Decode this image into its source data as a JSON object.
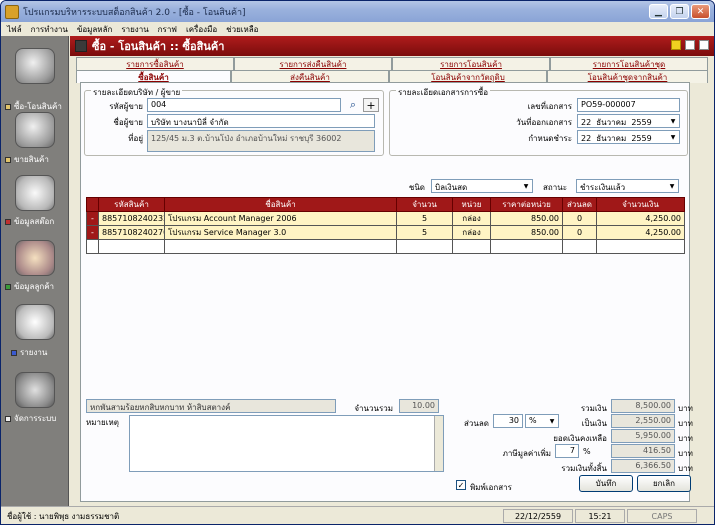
{
  "window": {
    "title": "โปรแกรมบริหารระบบสต็อกสินค้า 2.0  - [ซื้อ - โอนสินค้า]"
  },
  "menu": [
    "ไฟล์",
    "การทำงาน",
    "ข้อมูลหลัก",
    "รายงาน",
    "กราฟ",
    "เครื่องมือ",
    "ช่วยเหลือ"
  ],
  "sidebar": [
    {
      "label": "ซื้อ-โอนสินค้า",
      "icon": "magnifier-icon"
    },
    {
      "label": "ขายสินค้า",
      "icon": "magnifier-icon"
    },
    {
      "label": "ข้อมูลสต๊อก",
      "icon": "documents-icon"
    },
    {
      "label": "ข้อมูลลูกค้า",
      "icon": "customer-icon"
    },
    {
      "label": "รายงาน",
      "icon": "printer-icon"
    },
    {
      "label": "จัดการระบบ",
      "icon": "gears-icon"
    }
  ],
  "header": {
    "title": "ซื้อ - โอนสินค้า :: ซื้อสินค้า"
  },
  "tabs_top": [
    "รายการซื้อสินค้า",
    "รายการส่งคืนสินค้า",
    "รายการโอนสินค้า",
    "รายการโอนสินค้าชุด"
  ],
  "tabs_bottom": [
    "ซื้อสินค้า",
    "ส่งคืนสินค้า",
    "โอนสินค้าจากวัตถุดิบ",
    "โอนสินค้าชุดจากสินค้า"
  ],
  "supplier": {
    "group_title": "รายละเอียดบริษัท / ผู้ขาย",
    "code_label": "รหัสผู้ขาย",
    "code_value": "004",
    "name_label": "ชื่อผู้ขาย",
    "name_value": "บริษัท บางนาบิลี่ จำกัด",
    "addr_label": "ที่อยู่",
    "addr_value": "125/45 ม.3 ต.บ้านโป่ง อำเภอบ้านใหม่ ราชบุรี 36002"
  },
  "doc": {
    "group_title": "รายละเอียดเอกสารการซื้อ",
    "no_label": "เลขที่เอกสาร",
    "no_value": "PO59-000007",
    "date_label": "วันที่ออกเอกสาร",
    "date_d": "22",
    "date_m": "ธันวาคม",
    "date_y": "2559",
    "due_label": "กำหนดชำระ",
    "due_d": "22",
    "due_m": "ธันวาคม",
    "due_y": "2559",
    "type_label": "ชนิด",
    "type_value": "บิลเงินสด",
    "status_label": "สถานะ",
    "status_value": "ชำระเงินแล้ว"
  },
  "grid": {
    "headers": [
      "รหัสสินค้า",
      "ชื่อสินค้า",
      "จำนวน",
      "หน่วย",
      "ราคาต่อหน่วย",
      "ส่วนลด",
      "จำนวนเงิน"
    ],
    "rows": [
      {
        "mark": "-",
        "code": "8857108240232",
        "name": "โปรแกรม Account Manager 2006",
        "qty": "5",
        "unit": "กล่อง",
        "price": "850.00",
        "disc": "0",
        "amount": "4,250.00"
      },
      {
        "mark": "-",
        "code": "8857108240270",
        "name": "โปรแกรม Service Manager 3.0",
        "qty": "5",
        "unit": "กล่อง",
        "price": "850.00",
        "disc": "0",
        "amount": "4,250.00"
      }
    ],
    "add_mark": "+"
  },
  "footer": {
    "amount_text": "หกพันสามร้อยหกสิบหกบาท ห้าสิบสตางค์",
    "qty_total_label": "จำนวนรวม",
    "qty_total_value": "10.00",
    "note_label": "หมายเหตุ",
    "sum_label": "รวมเงิน",
    "sum_value": "8,500.00",
    "disc_label": "ส่วนลด",
    "disc_input": "30",
    "disc_unit": "%",
    "disc_money_label": "เป็นเงิน",
    "disc_money_value": "2,550.00",
    "after_disc_label": "ยอดเงินคงเหลือ",
    "after_disc_value": "5,950.00",
    "vat_label": "ภาษีมูลค่าเพิ่ม",
    "vat_input": "7",
    "vat_pct": "%",
    "vat_value": "416.50",
    "total_label": "รวมเงินทั้งสิ้น",
    "total_value": "6,366.50",
    "baht": "บาท",
    "print_label": "พิมพ์เอกสาร",
    "save_label": "บันทึก",
    "cancel_label": "ยกเลิก"
  },
  "status": {
    "user": "ชื่อผู้ใช้ : นายพิพุธ งามธรรมชาติ",
    "date": "22/12/2559",
    "time": "15:21",
    "caps": "CAPS"
  }
}
